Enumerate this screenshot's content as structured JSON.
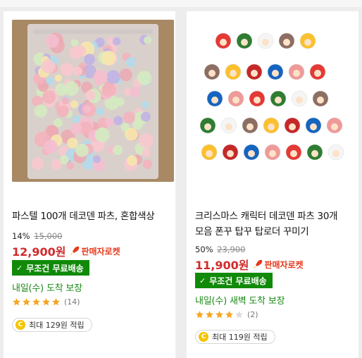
{
  "products": [
    {
      "title": "파스텔 100개 데코덴 파츠, 혼합색상",
      "title_line2": "",
      "discount": "14%",
      "original_price": "15,000",
      "price": "12,900원",
      "rocket_label": "판매자로켓",
      "badge": "무조건 무료배송",
      "delivery": "내일(수) 도착 보장",
      "rating": 5,
      "review_count": "(14)",
      "points": "최대 129원 적립",
      "image_icon": "pastel-parts-bag-photo"
    },
    {
      "title": "크리스마스 캐릭터 데코덴 파츠 30개",
      "title_line2": "모음 폰꾸 탑꾸 탑로더 꾸미기",
      "discount": "50%",
      "original_price": "23,900",
      "price": "11,900원",
      "rocket_label": "판매자로켓",
      "badge": "무조건 무료배송",
      "delivery": "내일(수) 새벽 도착 보장",
      "rating": 4,
      "review_count": "(2)",
      "points": "최대 119원 적립",
      "image_icon": "christmas-charms-photo"
    }
  ],
  "colors": {
    "price": "#d12b2b",
    "rocket": "#e53a1d",
    "badge_bg": "#118a0a",
    "delivery": "#1a8a16",
    "star": "#f5a623",
    "coin": "#f5c400"
  },
  "coin_symbol": "C"
}
